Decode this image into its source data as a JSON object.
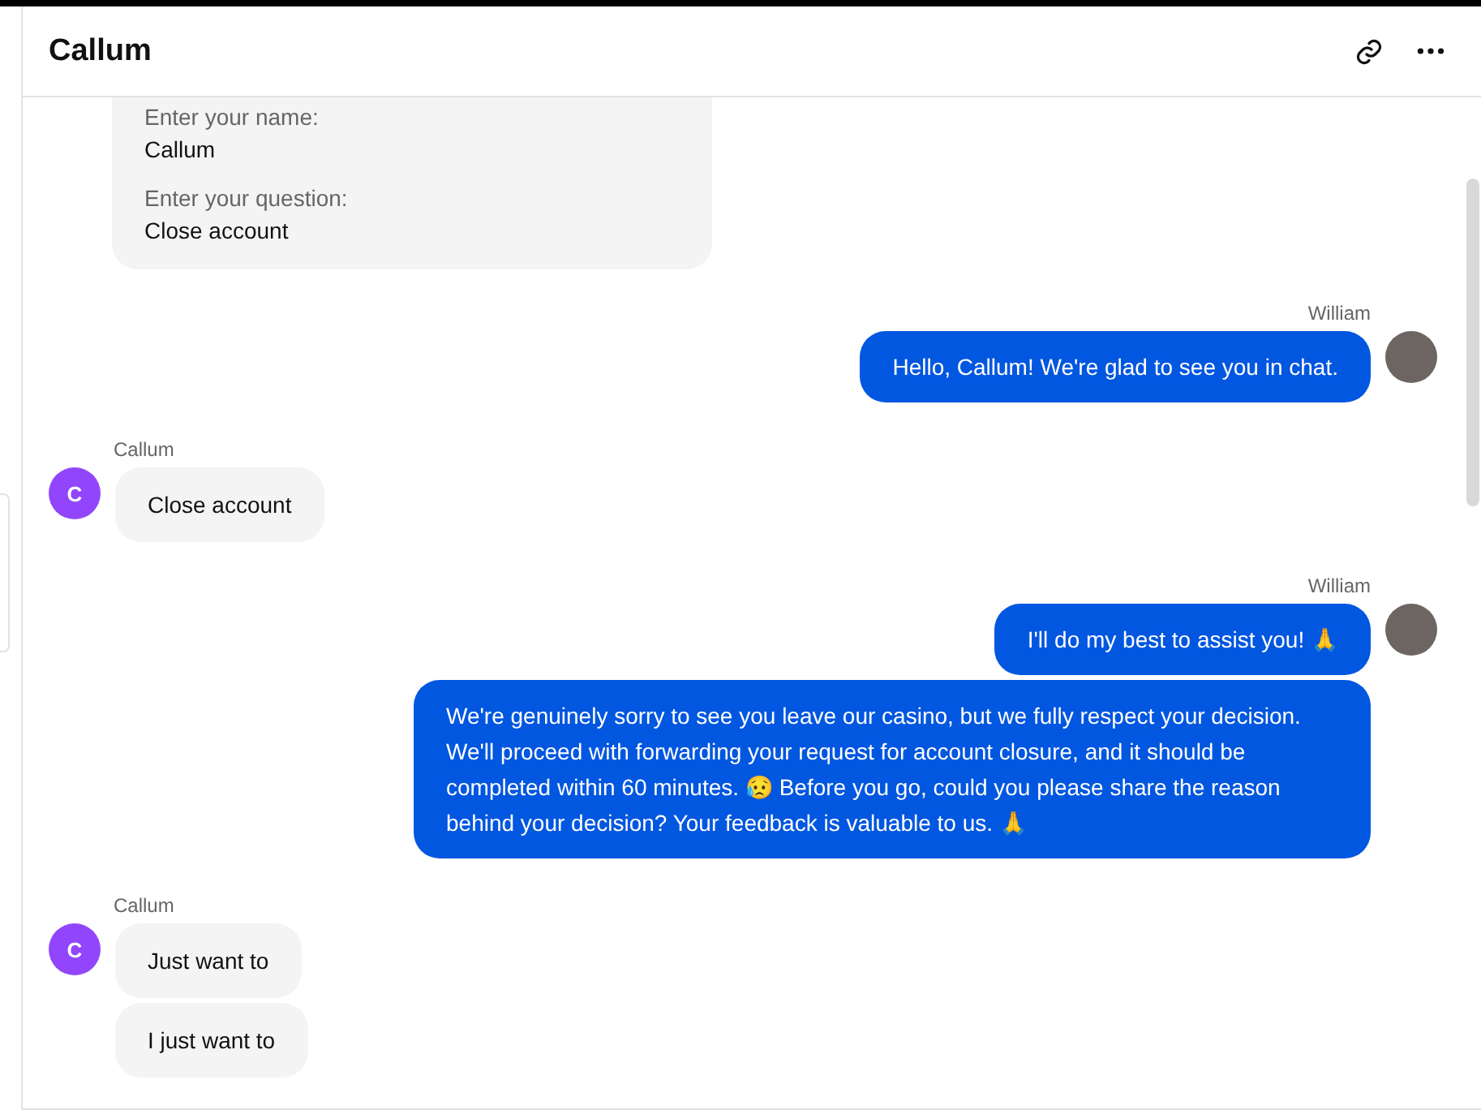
{
  "header": {
    "title": "Callum"
  },
  "messages": [
    {
      "kind": "form",
      "fields": [
        {
          "label": "Enter your name:",
          "value": "Callum"
        },
        {
          "label": "Enter your question:",
          "value": "Close account"
        }
      ]
    },
    {
      "kind": "agent",
      "sender": "William",
      "texts": [
        "Hello, Callum! We're glad to see you in chat."
      ]
    },
    {
      "kind": "client",
      "sender": "Callum",
      "initial": "C",
      "texts": [
        "Close account"
      ]
    },
    {
      "kind": "agent",
      "sender": "William",
      "texts": [
        "I'll do my best to assist you! 🙏",
        "We're genuinely sorry to see you leave our casino, but we fully respect your decision. We'll proceed with forwarding your request for account closure, and it should be completed within 60 minutes. 😥 Before you go, could you please share the reason behind your decision? Your feedback is valuable to us. 🙏"
      ]
    },
    {
      "kind": "client",
      "sender": "Callum",
      "initial": "C",
      "texts": [
        "Just want to",
        "I just want to"
      ]
    }
  ]
}
